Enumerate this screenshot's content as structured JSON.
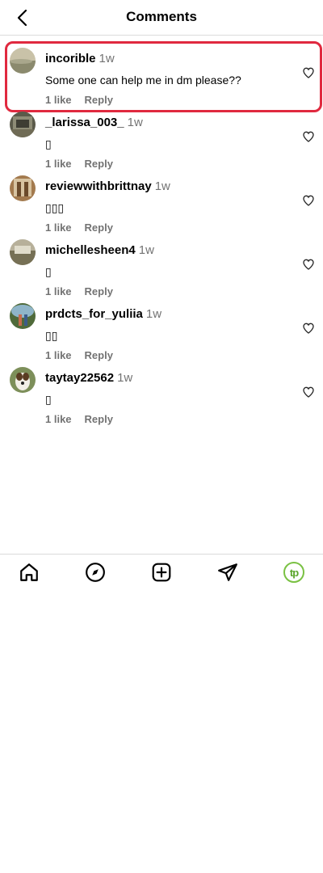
{
  "header": {
    "title": "Comments",
    "back_icon": "chevron-left-icon"
  },
  "comments": [
    {
      "username": "incorible",
      "time": "1w",
      "text": "Some one can help me in dm please??",
      "likes": "1 like",
      "reply": "Reply",
      "highlighted": true
    },
    {
      "username": "_larissa_003_",
      "time": "1w",
      "text": "▯",
      "likes": "1 like",
      "reply": "Reply"
    },
    {
      "username": "reviewwithbrittnay",
      "time": "1w",
      "text": "▯▯▯",
      "likes": "1 like",
      "reply": "Reply"
    },
    {
      "username": "michellesheen4",
      "time": "1w",
      "text": "▯",
      "likes": "1 like",
      "reply": "Reply"
    },
    {
      "username": "prdcts_for_yuliia",
      "time": "1w",
      "text": "▯▯",
      "likes": "1 like",
      "reply": "Reply"
    },
    {
      "username": "taytay22562",
      "time": "1w",
      "text": "▯",
      "likes": "1 like",
      "reply": "Reply"
    }
  ],
  "tabbar": {
    "items": [
      "home-icon",
      "explore-icon",
      "create-icon",
      "direct-icon",
      "profile-icon"
    ],
    "profile_label": "tp"
  },
  "colors": {
    "highlight": "#e0293f",
    "muted": "#737373",
    "profile_ring": "#7ac143"
  }
}
